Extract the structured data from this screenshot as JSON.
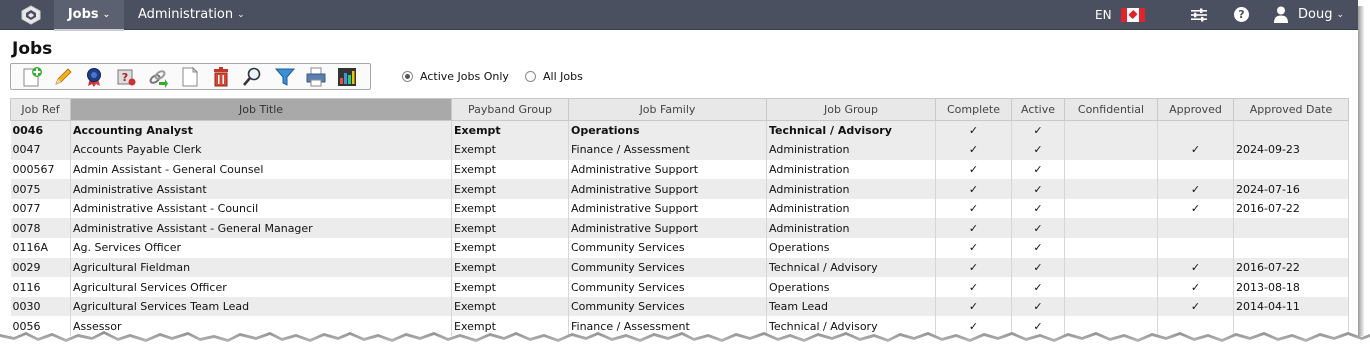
{
  "nav": {
    "tabs": [
      {
        "label": "Jobs"
      },
      {
        "label": "Administration"
      }
    ],
    "language": "EN",
    "user": "Doug"
  },
  "page": {
    "title": "Jobs"
  },
  "toolbar": {
    "icons": [
      "add-job-icon",
      "edit-icon",
      "award-icon",
      "help-question-icon",
      "link-icon",
      "document-icon",
      "delete-icon",
      "search-icon",
      "filter-icon",
      "print-icon",
      "report-icon"
    ]
  },
  "filters": {
    "active_only": "Active Jobs Only",
    "all_jobs": "All Jobs",
    "selected": "active_only"
  },
  "table": {
    "headers": [
      "Job Ref",
      "Job Title",
      "Payband Group",
      "Job Family",
      "Job Group",
      "Complete",
      "Active",
      "Confidential",
      "Approved",
      "Approved Date"
    ],
    "rows": [
      [
        "0046",
        "Accounting Analyst",
        "Exempt",
        "Operations",
        "Technical / Advisory",
        "✓",
        "✓",
        "",
        "",
        ""
      ],
      [
        "0047",
        "Accounts Payable Clerk",
        "Exempt",
        "Finance / Assessment",
        "Administration",
        "✓",
        "✓",
        "",
        "✓",
        "2024-09-23"
      ],
      [
        "000567",
        "Admin Assistant - General Counsel",
        "Exempt",
        "Administrative Support",
        "Administration",
        "✓",
        "✓",
        "",
        "",
        ""
      ],
      [
        "0075",
        "Administrative Assistant",
        "Exempt",
        "Administrative Support",
        "Administration",
        "✓",
        "✓",
        "",
        "✓",
        "2024-07-16"
      ],
      [
        "0077",
        "Administrative Assistant - Council",
        "Exempt",
        "Administrative Support",
        "Administration",
        "✓",
        "✓",
        "",
        "✓",
        "2016-07-22"
      ],
      [
        "0078",
        "Administrative Assistant - General Manager",
        "Exempt",
        "Administrative Support",
        "Administration",
        "✓",
        "✓",
        "",
        "",
        ""
      ],
      [
        "0116A",
        "Ag. Services Officer",
        "Exempt",
        "Community Services",
        "Operations",
        "✓",
        "✓",
        "",
        "",
        ""
      ],
      [
        "0029",
        "Agricultural Fieldman",
        "Exempt",
        "Community Services",
        "Technical / Advisory",
        "✓",
        "✓",
        "",
        "✓",
        "2016-07-22"
      ],
      [
        "0116",
        "Agricultural Services Officer",
        "Exempt",
        "Community Services",
        "Operations",
        "✓",
        "✓",
        "",
        "✓",
        "2013-08-18"
      ],
      [
        "0030",
        "Agricultural Services Team Lead",
        "Exempt",
        "Community Services",
        "Team Lead",
        "✓",
        "✓",
        "",
        "✓",
        "2014-04-11"
      ],
      [
        "0056",
        "Assessor",
        "Exempt",
        "Finance / Assessment",
        "Technical / Advisory",
        "✓",
        "✓",
        "",
        "",
        ""
      ]
    ]
  }
}
